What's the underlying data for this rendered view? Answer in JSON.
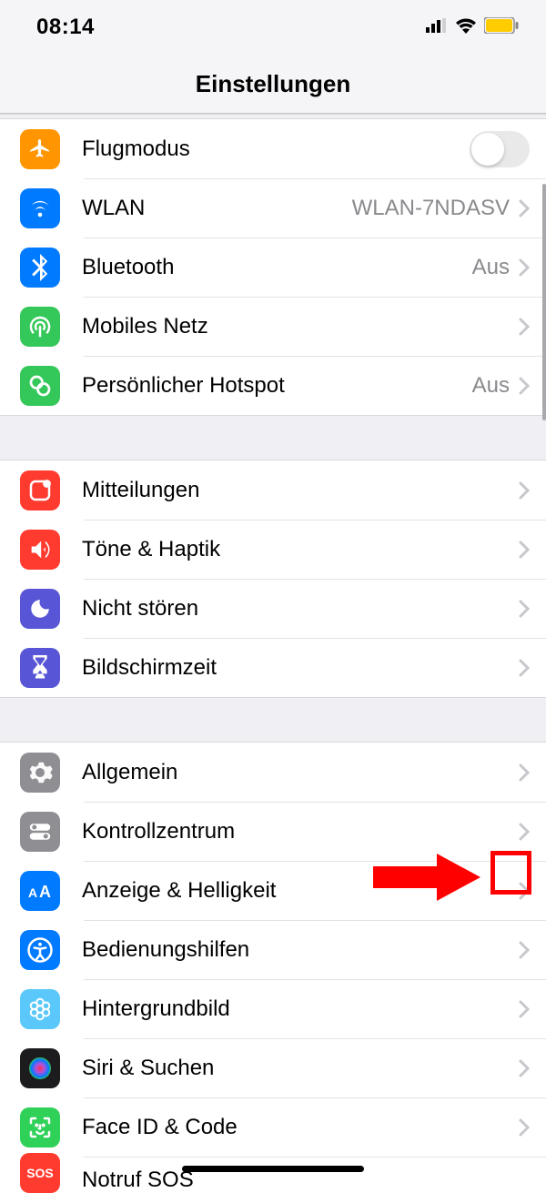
{
  "status": {
    "time": "08:14"
  },
  "header": {
    "title": "Einstellungen"
  },
  "groups": [
    {
      "rows": [
        {
          "icon": "airplane",
          "label": "Flugmodus",
          "control": "toggle"
        },
        {
          "icon": "wifi",
          "label": "WLAN",
          "value": "WLAN-7NDASV",
          "control": "chevron"
        },
        {
          "icon": "bluetooth",
          "label": "Bluetooth",
          "value": "Aus",
          "control": "chevron"
        },
        {
          "icon": "cellular",
          "label": "Mobiles Netz",
          "control": "chevron"
        },
        {
          "icon": "hotspot",
          "label": "Persönlicher Hotspot",
          "value": "Aus",
          "control": "chevron"
        }
      ]
    },
    {
      "rows": [
        {
          "icon": "notifications",
          "label": "Mitteilungen",
          "control": "chevron"
        },
        {
          "icon": "sounds",
          "label": "Töne & Haptik",
          "control": "chevron"
        },
        {
          "icon": "dnd",
          "label": "Nicht stören",
          "control": "chevron"
        },
        {
          "icon": "screentime",
          "label": "Bildschirmzeit",
          "control": "chevron"
        }
      ]
    },
    {
      "rows": [
        {
          "icon": "general",
          "label": "Allgemein",
          "control": "chevron"
        },
        {
          "icon": "controlcenter",
          "label": "Kontrollzentrum",
          "control": "chevron"
        },
        {
          "icon": "display",
          "label": "Anzeige & Helligkeit",
          "control": "chevron",
          "highlight": true
        },
        {
          "icon": "accessibility",
          "label": "Bedienungshilfen",
          "control": "chevron"
        },
        {
          "icon": "wallpaper",
          "label": "Hintergrundbild",
          "control": "chevron"
        },
        {
          "icon": "siri",
          "label": "Siri & Suchen",
          "control": "chevron"
        },
        {
          "icon": "faceid",
          "label": "Face ID & Code",
          "control": "chevron"
        },
        {
          "icon": "sos",
          "label": "Notruf SOS",
          "control": "chevron"
        }
      ]
    }
  ]
}
